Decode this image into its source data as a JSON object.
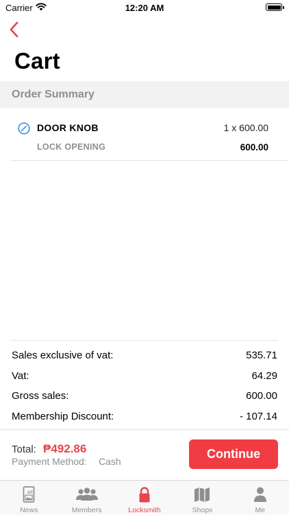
{
  "status_bar": {
    "carrier": "Carrier",
    "time": "12:20 AM"
  },
  "header": {
    "title": "Cart"
  },
  "order_summary": {
    "heading": "Order Summary",
    "items": [
      {
        "name": "DOOR KNOB",
        "quantity_text": "1  x  600.00",
        "subtitle": "LOCK OPENING",
        "line_total": "600.00"
      }
    ]
  },
  "totals": {
    "rows": [
      {
        "label": "Sales exclusive of vat:",
        "value": "535.71"
      },
      {
        "label": "Vat:",
        "value": "64.29"
      },
      {
        "label": "Gross sales:",
        "value": "600.00"
      },
      {
        "label": "Membership Discount:",
        "value": "- 107.14"
      }
    ]
  },
  "checkout": {
    "total_label": "Total:",
    "total_amount": "₱492.86",
    "payment_label": "Payment Method:",
    "payment_value": "Cash",
    "continue_label": "Continue"
  },
  "tab_bar": {
    "tabs": [
      {
        "label": "News",
        "icon": "news-icon",
        "active": false
      },
      {
        "label": "Members",
        "icon": "members-icon",
        "active": false
      },
      {
        "label": "Locksmith",
        "icon": "lock-icon",
        "active": true
      },
      {
        "label": "Shops",
        "icon": "map-icon",
        "active": false
      },
      {
        "label": "Me",
        "icon": "person-icon",
        "active": false
      }
    ]
  },
  "colors": {
    "accent": "#f03d43",
    "muted": "#8e8e8e",
    "section_bg": "#f2f2f2",
    "status_icon_blue": "#3a8ee6"
  }
}
